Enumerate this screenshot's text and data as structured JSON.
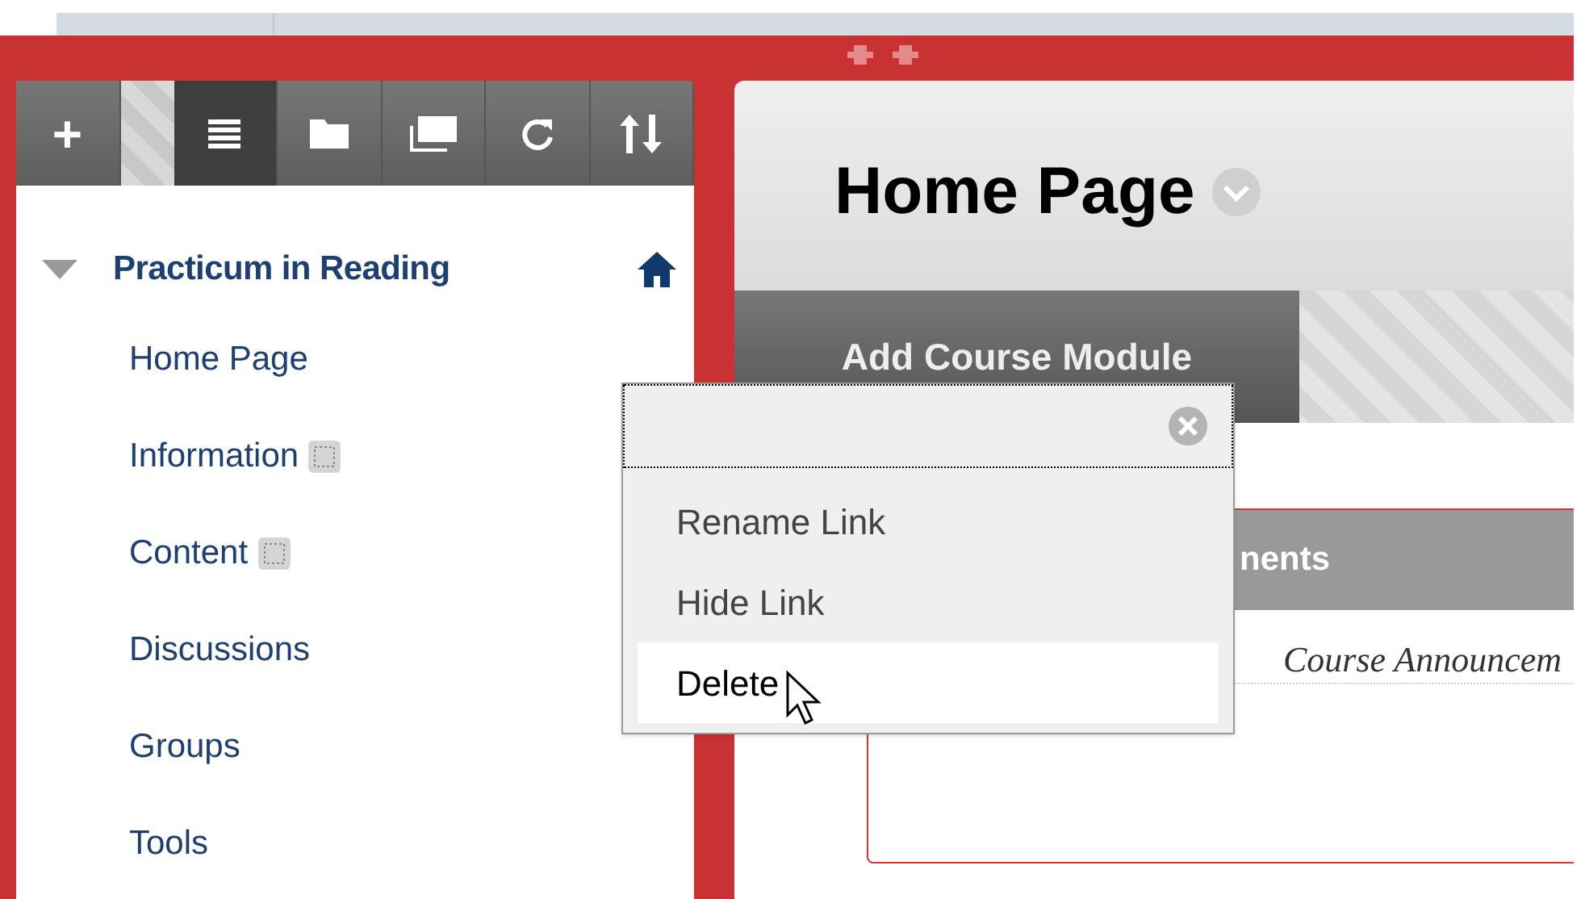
{
  "toolbar": [
    {
      "label": "+",
      "kind": "text",
      "selected": false
    },
    {
      "kind": "list",
      "selected": true
    },
    {
      "kind": "folder",
      "selected": false
    },
    {
      "kind": "windows",
      "selected": false
    },
    {
      "kind": "refresh",
      "selected": false
    },
    {
      "kind": "sort",
      "selected": false
    }
  ],
  "course_menu": {
    "title": "Practicum in Reading",
    "expanded": true,
    "items": [
      {
        "label": "Home Page",
        "hidden_to_students": false
      },
      {
        "label": "Information",
        "hidden_to_students": true
      },
      {
        "label": "Content",
        "hidden_to_students": true
      },
      {
        "label": "Discussions",
        "hidden_to_students": false
      },
      {
        "label": "Groups",
        "hidden_to_students": false
      },
      {
        "label": "Tools",
        "hidden_to_students": false
      }
    ]
  },
  "page": {
    "title": "Home Page",
    "tabs": [
      {
        "label": "Add Course Module"
      }
    ],
    "module": {
      "title": "nents",
      "body": "Course Announcem"
    }
  },
  "context_menu": {
    "items": [
      {
        "label": "Rename Link",
        "selected": false
      },
      {
        "label": "Hide Link",
        "selected": false
      },
      {
        "label": "Delete",
        "selected": true
      }
    ]
  }
}
